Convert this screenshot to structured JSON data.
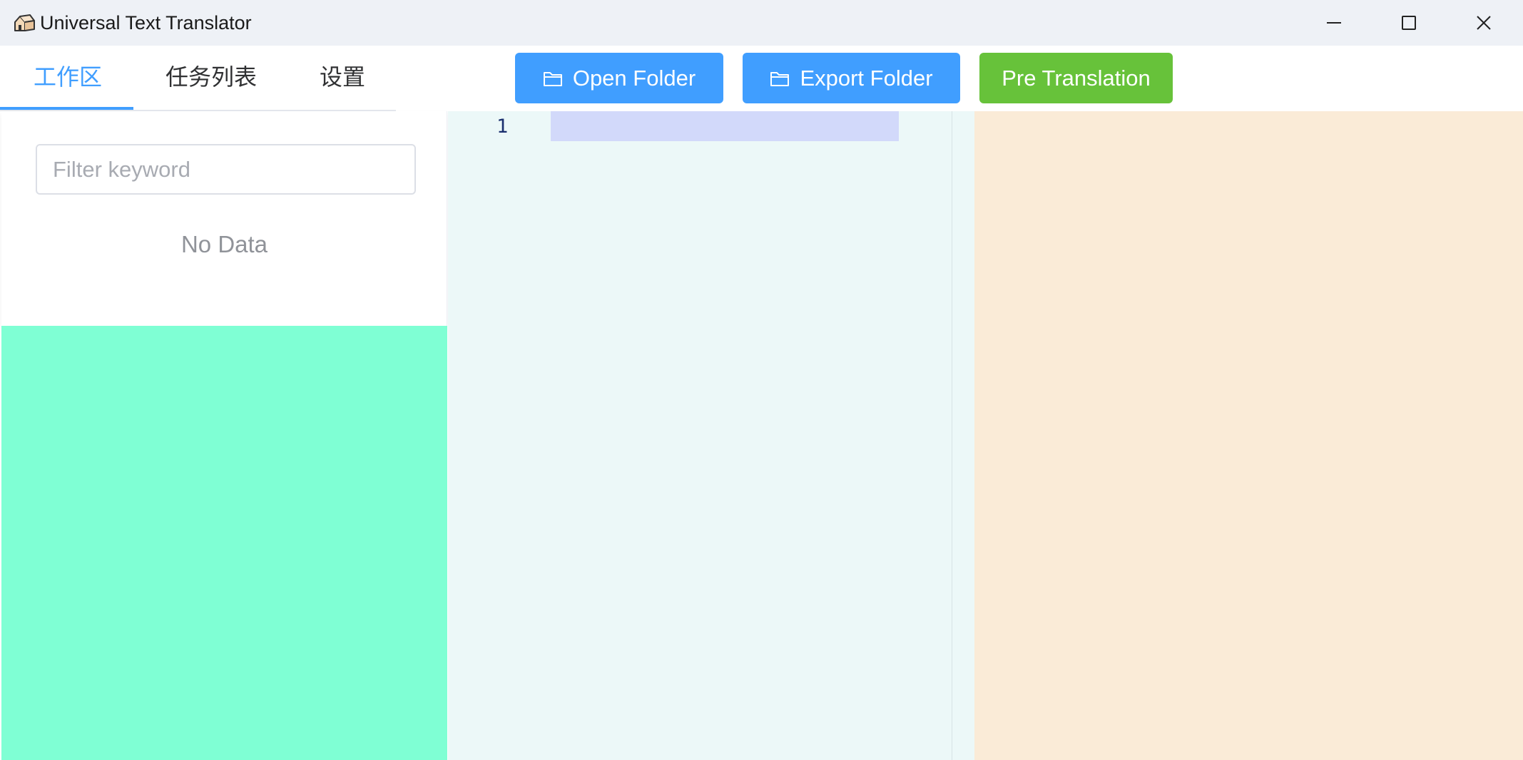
{
  "window": {
    "title": "Universal Text Translator",
    "controls": [
      "minimize",
      "maximize",
      "close"
    ]
  },
  "tabs": [
    {
      "label": "工作区",
      "active": true
    },
    {
      "label": "任务列表",
      "active": false
    },
    {
      "label": "设置",
      "active": false
    }
  ],
  "toolbar": {
    "open_folder_label": "Open Folder",
    "export_folder_label": "Export Folder",
    "pre_translation_label": "Pre Translation"
  },
  "sidebar": {
    "filter_placeholder": "Filter keyword",
    "filter_value": "",
    "empty_text": "No Data"
  },
  "editor": {
    "line_numbers": [
      "1"
    ],
    "content": ""
  },
  "colors": {
    "primary": "#409eff",
    "success": "#67c23a",
    "sidebar_fill": "#7fffd4",
    "editor_bg": "#ecf8f8",
    "right_panel_bg": "#faebd7",
    "line_highlight": "#d2d9fa"
  },
  "icons": {
    "app": "house-icon",
    "folder": "folder-icon"
  }
}
